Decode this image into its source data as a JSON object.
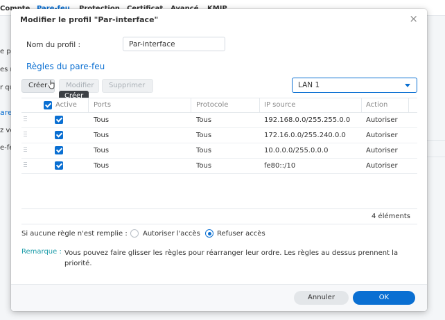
{
  "background": {
    "tabs": [
      "Compte",
      "Pare-feu",
      "Protection",
      "Certificat",
      "Avancé",
      "KMIP"
    ],
    "side_texts": [
      "e pa",
      "es r",
      "r qu",
      "are-",
      "z vo",
      "e-fe"
    ]
  },
  "dialog": {
    "title": "Modifier le profil \"Par-interface\"",
    "close_label": "×",
    "profile_name_label": "Nom du profil :",
    "profile_name_value": "Par-interface",
    "section_title": "Règles du pare-feu",
    "toolbar": {
      "create": "Créer",
      "modify": "Modifier",
      "delete": "Supprimer",
      "tooltip": "Créer"
    },
    "interface_select": "LAN 1",
    "table": {
      "headers": [
        "Active",
        "Ports",
        "Protocole",
        "IP source",
        "Action"
      ],
      "rows": [
        {
          "active": true,
          "ports": "Tous",
          "protocol": "Tous",
          "source_ip": "192.168.0.0/255.255.0.0",
          "action": "Autoriser"
        },
        {
          "active": true,
          "ports": "Tous",
          "protocol": "Tous",
          "source_ip": "172.16.0.0/255.240.0.0",
          "action": "Autoriser"
        },
        {
          "active": true,
          "ports": "Tous",
          "protocol": "Tous",
          "source_ip": "10.0.0.0/255.0.0.0",
          "action": "Autoriser"
        },
        {
          "active": true,
          "ports": "Tous",
          "protocol": "Tous",
          "source_ip": "fe80::/10",
          "action": "Autoriser"
        }
      ],
      "count": "4 éléments"
    },
    "no_match_label": "Si aucune règle n'est remplie :",
    "no_match_options": [
      "Autoriser l'accès",
      "Refuser accès"
    ],
    "no_match_selected": "Refuser accès",
    "note_label": "Remarque :",
    "note_text": "Vous pouvez faire glisser les règles pour réarranger leur ordre. Les règles au dessus prennent la priorité.",
    "footer": {
      "cancel": "Annuler",
      "ok": "OK"
    }
  },
  "colors": {
    "accent": "#0a6fd2",
    "note": "#1a9ba8"
  }
}
